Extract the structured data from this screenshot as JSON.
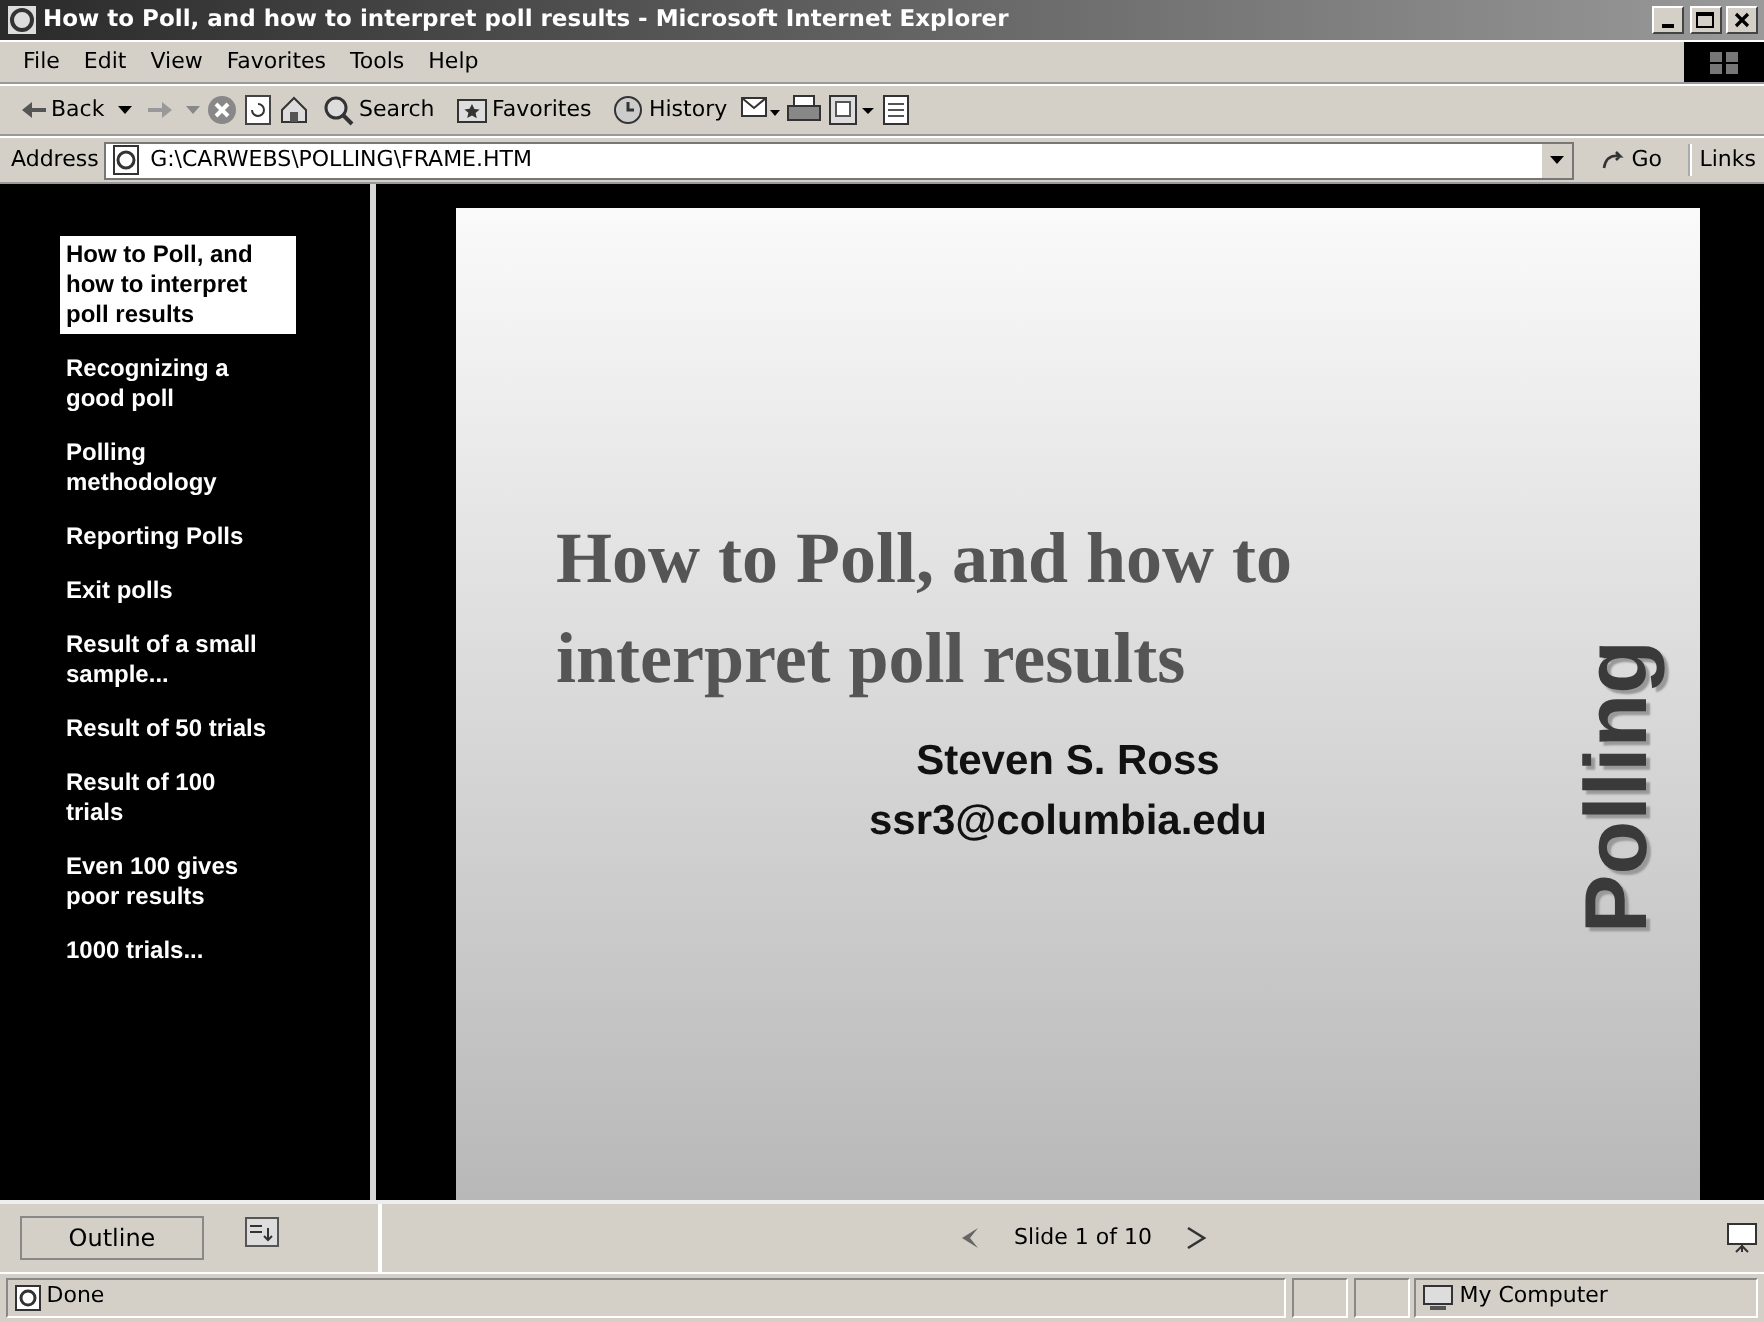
{
  "window": {
    "title": "How to Poll, and how to interpret poll results - Microsoft Internet Explorer"
  },
  "menu": [
    "File",
    "Edit",
    "View",
    "Favorites",
    "Tools",
    "Help"
  ],
  "toolbar": {
    "back": {
      "label": "Back"
    },
    "forward": {
      "disabled": true
    },
    "buttons": [
      "Search",
      "Favorites",
      "History"
    ]
  },
  "address": {
    "label": "Address",
    "value": "G:\\CARWEBS\\POLLING\\FRAME.HTM",
    "go": "Go",
    "links": "Links"
  },
  "outline": [
    {
      "label": "How to Poll, and how to interpret poll results",
      "selected": true
    },
    {
      "label": "Recognizing a good poll",
      "selected": false
    },
    {
      "label": "Polling methodology",
      "selected": false
    },
    {
      "label": "Reporting Polls",
      "selected": false
    },
    {
      "label": "Exit polls",
      "selected": false
    },
    {
      "label": "Result of a small sample...",
      "selected": false
    },
    {
      "label": "Result of 50 trials",
      "selected": false
    },
    {
      "label": "Result of 100 trials",
      "selected": false
    },
    {
      "label": "Even 100 gives poor results",
      "selected": false
    },
    {
      "label": "1000 trials...",
      "selected": false
    }
  ],
  "slide": {
    "title": "How to Poll, and how to interpret poll results",
    "author": "Steven S. Ross",
    "email": "ssr3@columbia.edu",
    "side_title": "Polling"
  },
  "nav": {
    "outline_button": "Outline",
    "counter": "Slide 1 of 10"
  },
  "status_bar": {
    "text": "Done",
    "zone": "My Computer"
  }
}
